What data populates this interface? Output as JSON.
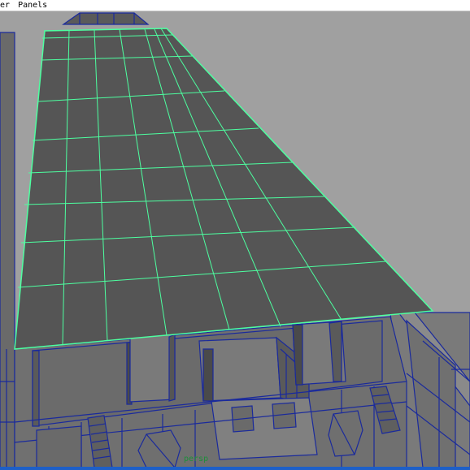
{
  "menu": {
    "items": [
      "rer",
      "Panels"
    ]
  },
  "viewport": {
    "camera_label": "persp",
    "colors": {
      "background": "#a0a0a0",
      "wireframe": "#1a2a9c",
      "selection": "#4dffa0",
      "face": "#555555"
    }
  }
}
